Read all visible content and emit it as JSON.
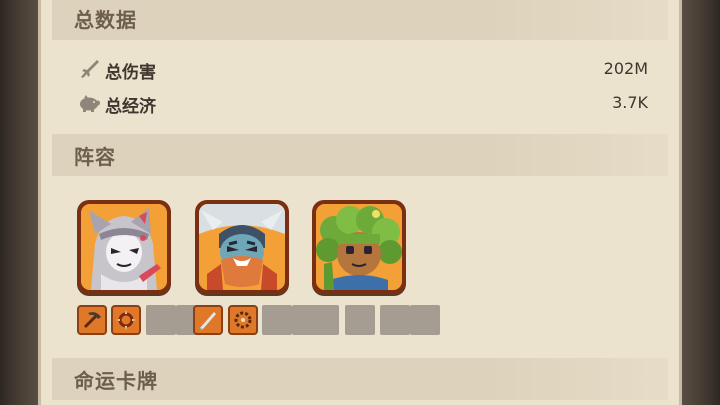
{
  "total_data": {
    "title": "总数据",
    "stats": [
      {
        "icon": "sword-icon",
        "label": "总伤害",
        "value": "202M"
      },
      {
        "icon": "piggy-bank-icon",
        "label": "总经济",
        "value": "3.7K"
      }
    ]
  },
  "lineup": {
    "title": "阵容",
    "heroes": [
      {
        "portrait": "fox-eared-swordsman-portrait",
        "items": [
          "pickaxe-icon",
          "spiked-ring-icon",
          "empty",
          "empty"
        ]
      },
      {
        "portrait": "horned-bearded-warrior-portrait",
        "items": [
          "blade-icon",
          "chain-ring-icon",
          "empty",
          "empty"
        ]
      },
      {
        "portrait": "leafy-forest-guardian-portrait",
        "items": [
          "empty",
          "empty",
          "empty",
          "empty"
        ]
      }
    ]
  },
  "fate_cards": {
    "title": "命运卡牌"
  },
  "colors": {
    "panel_bg": "#ece3cf",
    "header_bg": "#ddd2bb",
    "title_text": "#6e5f4d",
    "body_text": "#3f372f",
    "card_orange": "#f09a2a",
    "item_orange": "#e0782a",
    "empty_slot": "#a59d92"
  }
}
